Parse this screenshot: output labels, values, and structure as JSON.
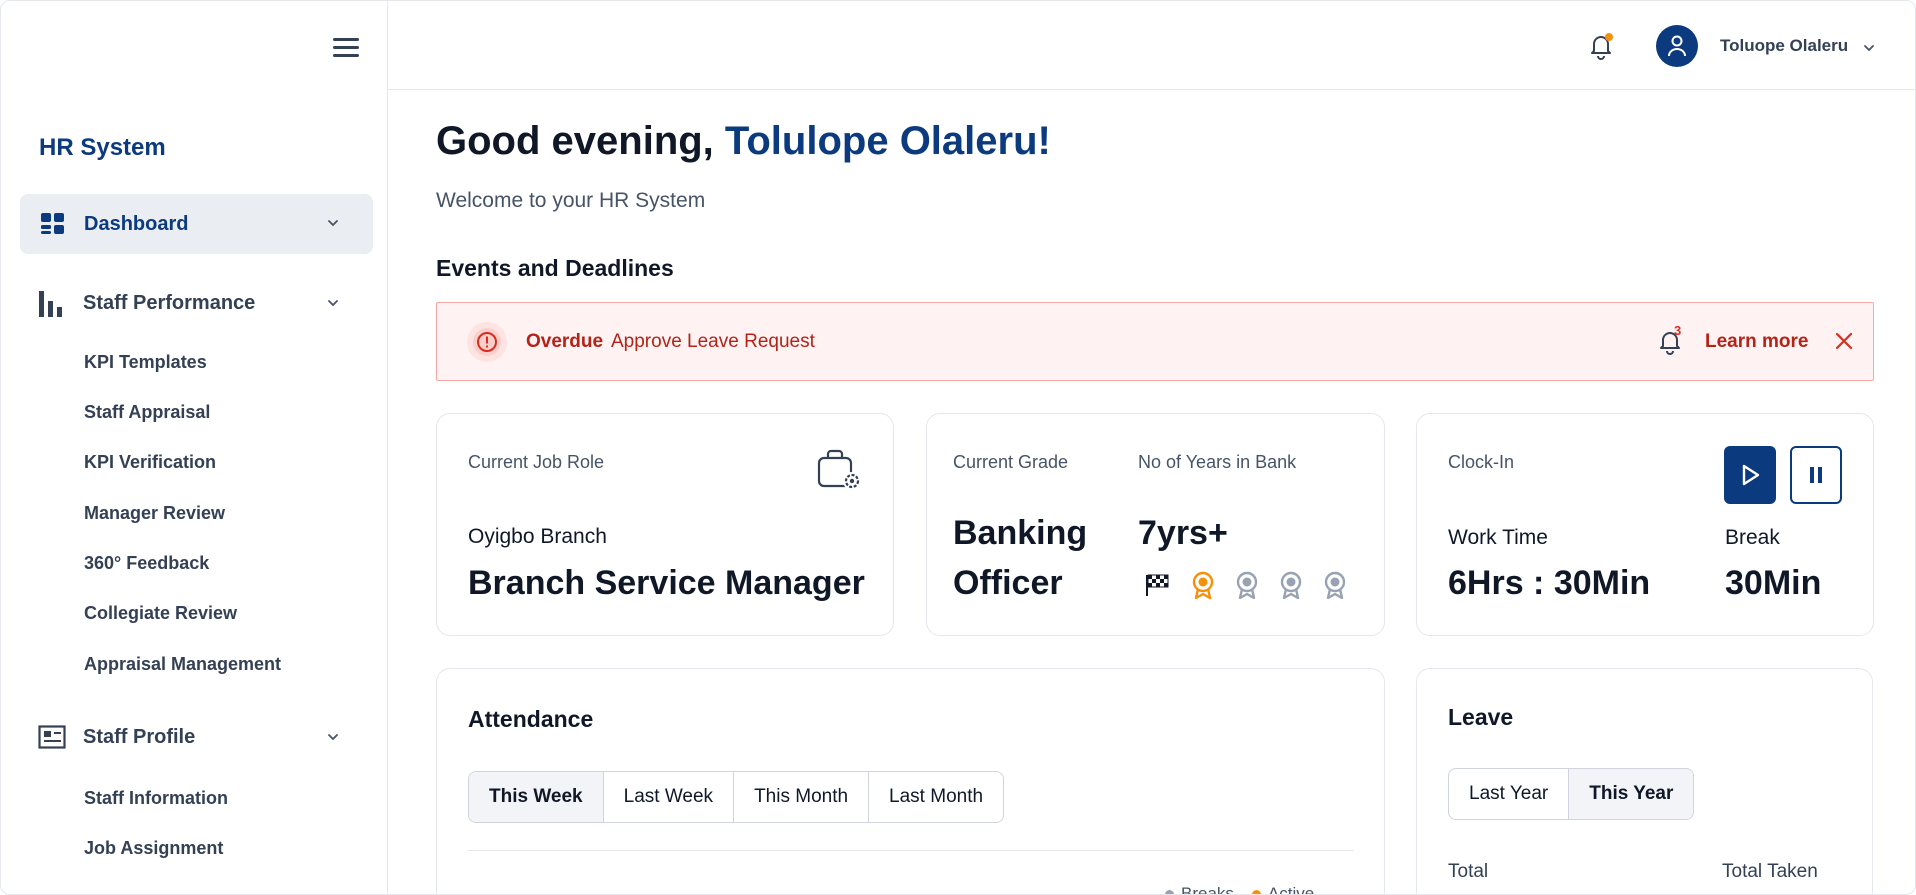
{
  "sidebar": {
    "brand": "HR System",
    "active": {
      "label": "Dashboard",
      "icon": "dashboard-icon"
    },
    "groups": [
      {
        "label": "Staff Performance",
        "icon": "bar-chart-icon",
        "items": [
          "KPI Templates",
          "Staff Appraisal",
          "KPI Verification",
          "Manager Review",
          "360° Feedback",
          "Collegiate Review",
          "Appraisal Management"
        ]
      },
      {
        "label": "Staff Profile",
        "icon": "id-card-icon",
        "items": [
          "Staff Information",
          "Job Assignment"
        ]
      }
    ]
  },
  "header": {
    "user_name": "Toluope Olaleru",
    "notification_dot_color": "#f79009"
  },
  "main": {
    "greeting_prefix": "Good evening, ",
    "greeting_name": "Tolulope Olaleru!",
    "welcome": "Welcome to your HR System",
    "events_title": "Events and Deadlines",
    "alert": {
      "tag": "Overdue",
      "text": "Approve Leave Request",
      "bell_count": "3",
      "link": "Learn more"
    },
    "job_card": {
      "label": "Current Job Role",
      "branch": "Oyigbo Branch",
      "role": "Branch Service Manager"
    },
    "grade_card": {
      "grade_label": "Current Grade",
      "grade_line1": "Banking",
      "grade_line2": "Officer",
      "years_label": "No of Years in Bank",
      "years_value": "7yrs+",
      "milestones_achieved": 2,
      "milestones_total": 5
    },
    "clock_card": {
      "label": "Clock-In",
      "work_label": "Work Time",
      "work_value": "6Hrs : 30Min",
      "break_label": "Break",
      "break_value": "30Min"
    },
    "attendance": {
      "title": "Attendance",
      "tabs": [
        "This Week",
        "Last Week",
        "This Month",
        "Last Month"
      ],
      "selected_tab": "This Week",
      "legend": [
        {
          "label": "Breaks",
          "color": "#98a2b3"
        },
        {
          "label": "Active",
          "color": "#f79009"
        }
      ]
    },
    "leave": {
      "title": "Leave",
      "tabs": [
        "Last Year",
        "This Year"
      ],
      "selected_tab": "This Year",
      "total_label": "Total",
      "taken_label": "Total Taken"
    }
  },
  "colors": {
    "brand": "#0b3a7e",
    "alert": "#b42318",
    "medal_active": "#f79009",
    "medal_inactive": "#98a2b3"
  }
}
